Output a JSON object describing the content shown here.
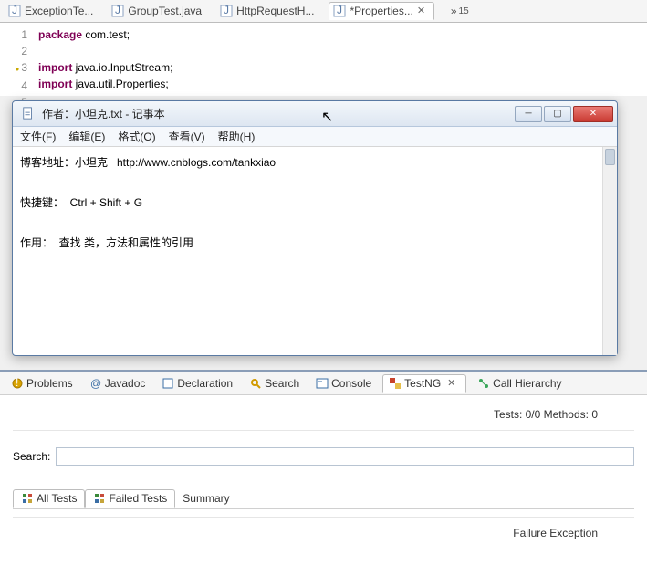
{
  "editor": {
    "tabs": [
      {
        "label": "ExceptionTe..."
      },
      {
        "label": "GroupTest.java"
      },
      {
        "label": "HttpRequestH..."
      },
      {
        "label": "*Properties..."
      }
    ],
    "overflow_label": "15",
    "code": {
      "lines": [
        "1",
        "2",
        "3",
        "4",
        "5"
      ],
      "l1_kw": "package",
      "l1_rest": " com.test;",
      "l3_kw": "import",
      "l3_rest": " java.io.InputStream;",
      "l4_kw": "import",
      "l4_rest": " java.util.Properties;"
    }
  },
  "notepad": {
    "title": "作者：小坦克.txt - 记事本",
    "menu": {
      "file": "文件(F)",
      "edit": "编辑(E)",
      "format": "格式(O)",
      "view": "查看(V)",
      "help": "帮助(H)"
    },
    "body_line1": "博客地址：小坦克   http://www.cnblogs.com/tankxiao",
    "body_line2": "快捷键：  Ctrl + Shift + G",
    "body_line3": "作用：  查找 类，方法和属性的引用"
  },
  "panel": {
    "tabs": {
      "problems": "Problems",
      "javadoc": "Javadoc",
      "declaration": "Declaration",
      "search": "Search",
      "console": "Console",
      "testng": "TestNG",
      "callhierarchy": "Call Hierarchy"
    },
    "status": "Tests: 0/0  Methods: 0",
    "search_label": "Search:",
    "search_value": "",
    "result_tabs": {
      "all": "All Tests",
      "failed": "Failed Tests",
      "summary": "Summary"
    },
    "failure_label": "Failure Exception"
  }
}
